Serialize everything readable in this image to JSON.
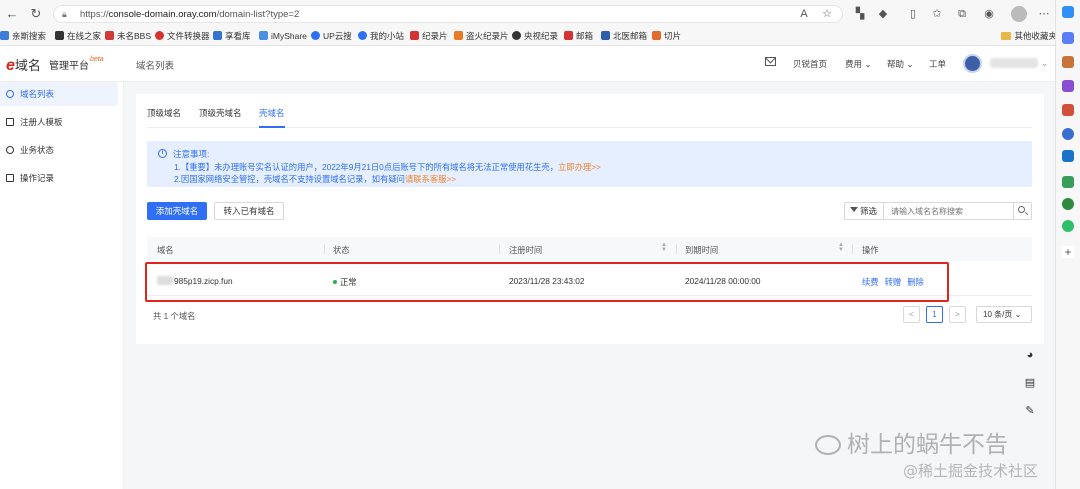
{
  "browser": {
    "url_prefix": "https://",
    "url_host": "console-domain.oray.com",
    "url_path": "/domain-list?type=2",
    "bookmarks": [
      {
        "label": "亲斯搜索",
        "color": "#3b7dd8"
      },
      {
        "label": "在线之家",
        "color": "#333333"
      },
      {
        "label": "未名BBS",
        "color": "#d03a3a"
      },
      {
        "label": "文件转换器",
        "color": "#d33333"
      },
      {
        "label": "享看库",
        "color": "#3573d0"
      },
      {
        "label": "iMyShare",
        "color": "#4a90e2"
      },
      {
        "label": "UP云搜",
        "color": "#2f6ff5"
      },
      {
        "label": "我的小站",
        "color": "#2f6ff5"
      },
      {
        "label": "纪录片",
        "color": "#d33333"
      },
      {
        "label": "盗火纪录片",
        "color": "#e87b24"
      },
      {
        "label": "央视纪录",
        "color": "#333333"
      },
      {
        "label": "邮箱",
        "color": "#d33333"
      },
      {
        "label": "北医邮箱",
        "color": "#2f5fa8"
      },
      {
        "label": "切片",
        "color": "#e26b2e"
      }
    ],
    "other_bookmarks": "其他收藏夹"
  },
  "header": {
    "logo_mark": "e",
    "logo_text": "域名",
    "platform": "管理平台",
    "beta": "beta",
    "page_title": "域名列表",
    "nav": {
      "home": "贝锐首页",
      "fees": "费用",
      "help": "帮助",
      "ticket": "工单"
    }
  },
  "sidebar": {
    "items": [
      {
        "label": "域名列表",
        "active": true
      },
      {
        "label": "注册人模板",
        "active": false
      },
      {
        "label": "业务状态",
        "active": false
      },
      {
        "label": "操作记录",
        "active": false
      }
    ]
  },
  "tabs": [
    {
      "label": "顶级域名"
    },
    {
      "label": "顶级壳域名"
    },
    {
      "label": "壳域名",
      "active": true
    }
  ],
  "notice": {
    "title": "注意事项:",
    "line1": "1.【重要】未办理账号实名认证的用户，2022年9月21日0点后账号下的所有域名将无法正常使用花生壳，",
    "line1_link": "立即办理>>",
    "line2": "2.因国家网络安全管控，壳域名不支持设置域名记录，如有疑问",
    "line2_link": "请联系客服>>"
  },
  "actions": {
    "add": "添加壳域名",
    "import": "转入已有域名",
    "filter": "筛选",
    "search_placeholder": "请输入域名名称搜索"
  },
  "table": {
    "columns": [
      "域名",
      "状态",
      "注册时间",
      "到期时间",
      "操作"
    ],
    "rows": [
      {
        "domain": "985p19.zicp.fun",
        "status": "正常",
        "registered": "2023/11/28 23:43:02",
        "expires": "2024/11/28 00:00:00",
        "ops": [
          "续费",
          "转赠",
          "删除"
        ]
      }
    ]
  },
  "pagination": {
    "total": "共 1 个域名",
    "prev": "<",
    "current": "1",
    "next": ">",
    "page_size": "10 条/页"
  },
  "watermark": {
    "line1": "树上的蜗牛不告",
    "line2": "@稀土掘金技术社区"
  },
  "colors": {
    "primary": "#2f6ff5",
    "highlight": "#e0251b",
    "success": "#22b14c",
    "link_orange": "#f5832b"
  }
}
